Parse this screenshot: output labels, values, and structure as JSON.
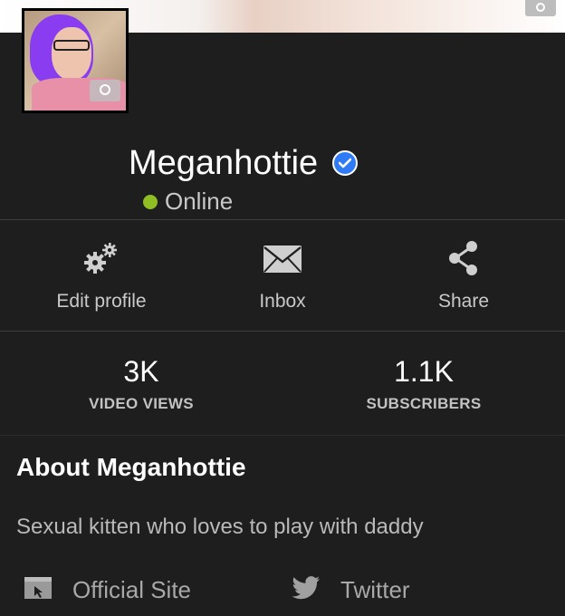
{
  "profile": {
    "name": "Meganhottie",
    "status": "Online",
    "verified": true,
    "status_color": "#8fbe24",
    "verified_color": "#2f7bf5"
  },
  "actions": [
    {
      "label": "Edit profile",
      "icon": "gears-icon"
    },
    {
      "label": "Inbox",
      "icon": "envelope-icon"
    },
    {
      "label": "Share",
      "icon": "share-icon"
    }
  ],
  "stats": [
    {
      "value": "3K",
      "caption": "VIDEO VIEWS"
    },
    {
      "value": "1.1K",
      "caption": "SUBSCRIBERS"
    }
  ],
  "about": {
    "title": "About Meganhottie",
    "text": "Sexual kitten who loves to play with daddy"
  },
  "links": [
    {
      "label": "Official Site",
      "icon": "browser-window-icon"
    },
    {
      "label": "Twitter",
      "icon": "twitter-bird-icon"
    }
  ]
}
